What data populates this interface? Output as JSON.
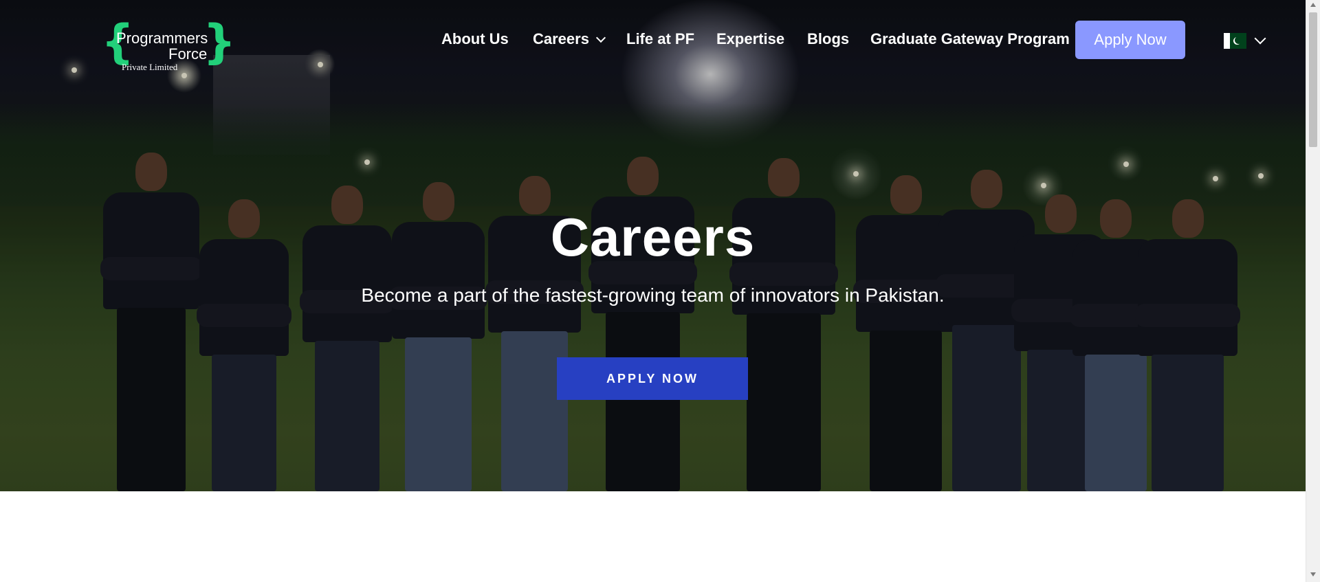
{
  "logo": {
    "line1": "Programmers",
    "line2": "Force",
    "line3": "Private Limited"
  },
  "nav": {
    "items": [
      {
        "label": "About Us",
        "has_dropdown": false
      },
      {
        "label": "Careers",
        "has_dropdown": true
      },
      {
        "label": "Life at PF",
        "has_dropdown": false
      },
      {
        "label": "Expertise",
        "has_dropdown": false
      },
      {
        "label": "Blogs",
        "has_dropdown": false
      },
      {
        "label": "Graduate Gateway Program",
        "has_dropdown": false
      }
    ],
    "apply_label": "Apply Now",
    "language_flag": "pakistan-flag-icon"
  },
  "hero": {
    "title": "Careers",
    "subtitle": "Become a part of the fastest-growing team of innovators in Pakistan.",
    "button_label": "APPLY NOW"
  },
  "colors": {
    "logo_brace": "#22d07a",
    "nav_button": "#8a98ff",
    "hero_button": "#2740c2"
  }
}
